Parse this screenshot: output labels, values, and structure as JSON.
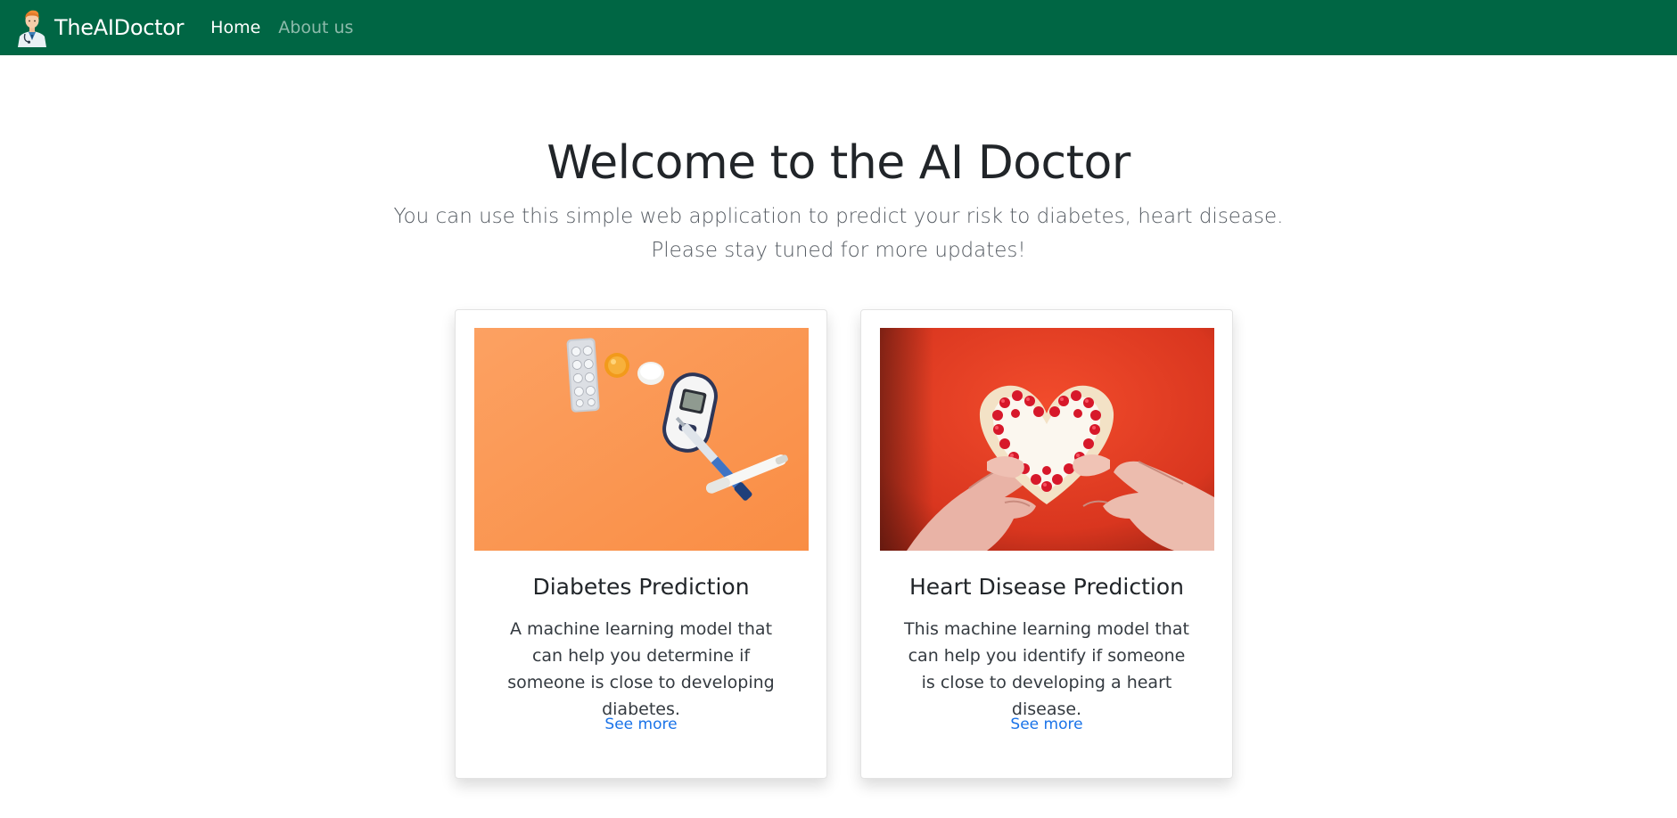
{
  "navbar": {
    "brand": "TheAIDoctor",
    "links": [
      {
        "label": "Home",
        "active": true
      },
      {
        "label": "About us",
        "active": false
      }
    ],
    "background": "#006644"
  },
  "hero": {
    "title": "Welcome to the AI Doctor",
    "lead_line1": "You can use this simple web application to predict your risk to diabetes, heart disease.",
    "lead_line2": "Please stay tuned for more updates!"
  },
  "cards": [
    {
      "title": "Diabetes Prediction",
      "text": "A machine learning model that can help you determine if someone is close to developing diabetes.",
      "link": "See more",
      "image_icon": "diabetes-supplies-photo"
    },
    {
      "title": "Heart Disease Prediction",
      "text": "This machine learning model that can help you identify if someone is close to developing a heart disease.",
      "link": "See more",
      "image_icon": "heart-cookie-photo"
    }
  ],
  "colors": {
    "navbar": "#006644",
    "link": "#1a73e8",
    "card1_bg": "#fb9a55",
    "card2_bg": "#e0442a"
  }
}
